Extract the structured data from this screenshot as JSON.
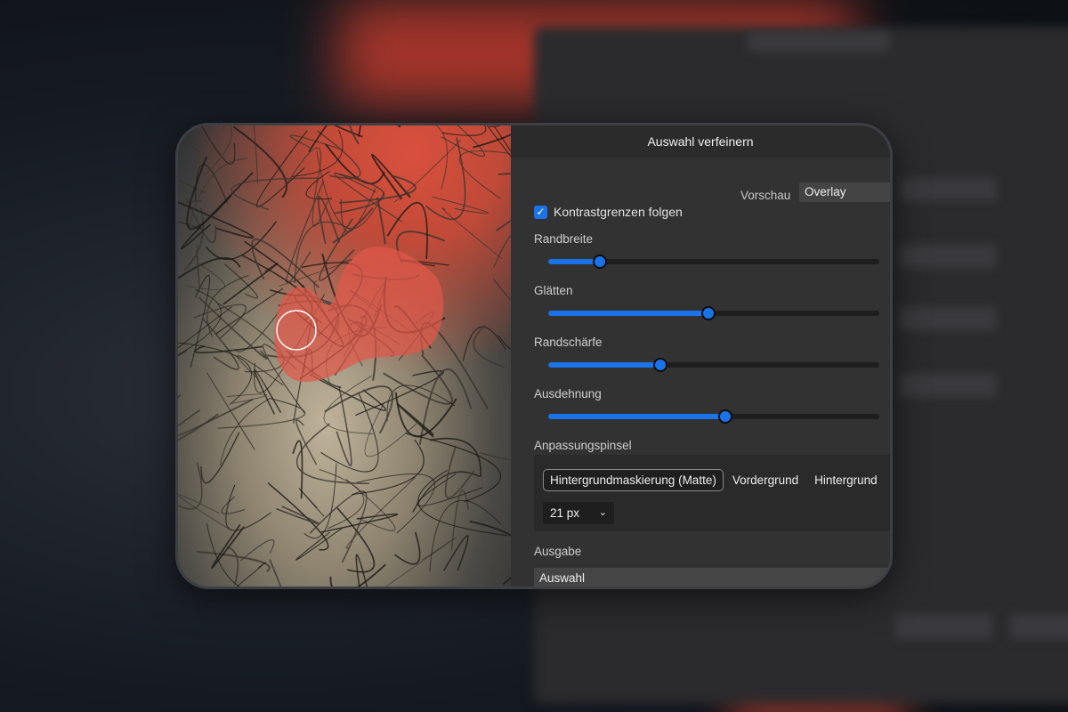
{
  "dialog": {
    "title": "Auswahl verfeinern"
  },
  "preview": {
    "label": "Vorschau",
    "value": "Overlay"
  },
  "follow_edges": {
    "label": "Kontrastgrenzen folgen",
    "checked": true,
    "check_glyph": "✓"
  },
  "sliders": [
    {
      "label": "Randbreite",
      "value": 0.155
    },
    {
      "label": "Glätten",
      "value": 0.485
    },
    {
      "label": "Randschärfe",
      "value": 0.34
    },
    {
      "label": "Ausdehnung",
      "value": 0.535
    }
  ],
  "brush": {
    "label": "Anpassungspinsel",
    "modes": [
      "Hintergrundmaskierung (Matte)",
      "Vordergrund",
      "Hintergrund"
    ],
    "active_mode": 0,
    "size": "21 px",
    "chevron": "⌄"
  },
  "output": {
    "label": "Ausgabe",
    "value": "Auswahl"
  },
  "colors": {
    "accent": "#1a73e8",
    "panel": "#323232",
    "overlay_red": "#e0574a"
  }
}
